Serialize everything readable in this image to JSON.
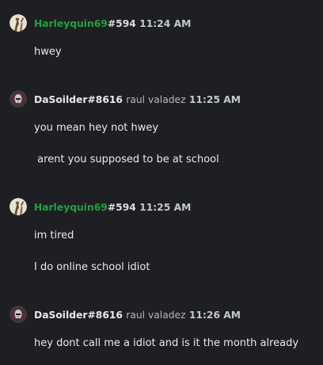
{
  "messages": [
    {
      "username": "Harleyquin69",
      "discriminator": "#594",
      "nickname": "",
      "timestamp": "11:24 AM",
      "username_color": "#23a042",
      "avatar_icon": "harleyquinn-avatar-icon",
      "lines": [
        "hwey"
      ]
    },
    {
      "username": "DaSoilder",
      "discriminator": "#8616",
      "nickname": "raul valadez",
      "timestamp": "11:25 AM",
      "username_color": "#e8e9ec",
      "avatar_icon": "helmet-avatar-icon",
      "lines": [
        "you mean hey not hwey",
        " arent you supposed to be at school"
      ]
    },
    {
      "username": "Harleyquin69",
      "discriminator": "#594",
      "nickname": "",
      "timestamp": "11:25 AM",
      "username_color": "#23a042",
      "avatar_icon": "harleyquinn-avatar-icon",
      "lines": [
        "im tired",
        "I do online school idiot"
      ]
    },
    {
      "username": "DaSoilder",
      "discriminator": "#8616",
      "nickname": "raul valadez",
      "timestamp": "11:26 AM",
      "username_color": "#e8e9ec",
      "avatar_icon": "helmet-avatar-icon",
      "lines": [
        "hey dont call me a idiot and is it the month already"
      ]
    }
  ]
}
